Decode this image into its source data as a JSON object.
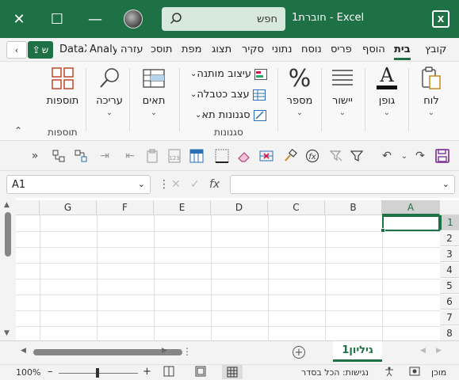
{
  "titlebar": {
    "title": "חוברת1  -  Excel",
    "search_text": "חפש",
    "close_glyph": "✕",
    "max_glyph": "☐",
    "min_glyph": "—",
    "app_icon": "X"
  },
  "tabs": [
    {
      "label": "קובץ"
    },
    {
      "label": "בית"
    },
    {
      "label": "הוסף"
    },
    {
      "label": "פריס"
    },
    {
      "label": "נוסח"
    },
    {
      "label": "נתוני"
    },
    {
      "label": "סקיר"
    },
    {
      "label": "תצוג"
    },
    {
      "label": "מפת"
    },
    {
      "label": "תוסכ"
    },
    {
      "label": "עזרה"
    },
    {
      "label": "Analy"
    },
    {
      "label": "DataX"
    }
  ],
  "share_label": "ש",
  "ribbon": {
    "clipboard": "לוח",
    "font": "גופן",
    "alignment": "יישור",
    "number": "מספר",
    "conditional": "עיצוב מותנה",
    "format_table": "עצב כטבלה",
    "cell_styles": "סגנונות תא",
    "styles_group": "סגנונות",
    "cells": "תאים",
    "editing": "עריכה",
    "addins": "תוספות",
    "addins_group": "תוספות"
  },
  "namebox": "A1",
  "fx_label": "fx",
  "columns": [
    "A",
    "B",
    "C",
    "D",
    "E",
    "F",
    "G"
  ],
  "rows": [
    "1",
    "2",
    "3",
    "4",
    "5",
    "6",
    "7",
    "8"
  ],
  "sheet_tab": "גיליון1",
  "status": {
    "ready": "מוכן",
    "accessibility": "נגישות: הכל בסדר",
    "zoom": "100%",
    "plus": "+",
    "minus": "–"
  },
  "colors": {
    "accent": "#1e7145"
  }
}
